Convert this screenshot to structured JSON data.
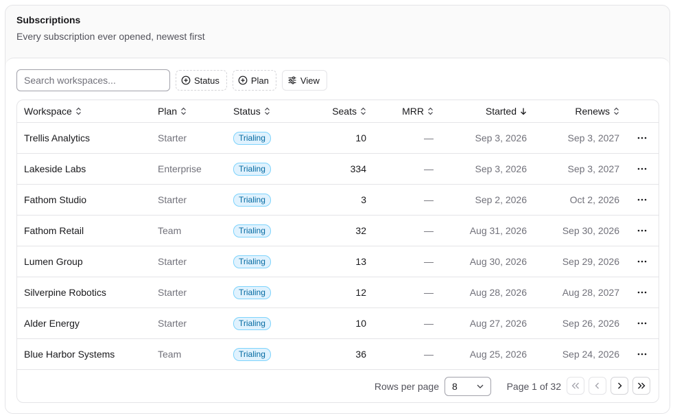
{
  "header": {
    "title": "Subscriptions",
    "subtitle": "Every subscription ever opened, newest first"
  },
  "toolbar": {
    "search_placeholder": "Search workspaces...",
    "status_label": "Status",
    "plan_label": "Plan",
    "view_label": "View"
  },
  "table": {
    "columns": {
      "workspace": "Workspace",
      "plan": "Plan",
      "status": "Status",
      "seats": "Seats",
      "mrr": "MRR",
      "started": "Started",
      "renews": "Renews"
    },
    "rows": [
      {
        "workspace": "Trellis Analytics",
        "plan": "Starter",
        "status": "Trialing",
        "seats": "10",
        "mrr": "—",
        "started": "Sep 3, 2026",
        "renews": "Sep 3, 2027"
      },
      {
        "workspace": "Lakeside Labs",
        "plan": "Enterprise",
        "status": "Trialing",
        "seats": "334",
        "mrr": "—",
        "started": "Sep 3, 2026",
        "renews": "Sep 3, 2027"
      },
      {
        "workspace": "Fathom Studio",
        "plan": "Starter",
        "status": "Trialing",
        "seats": "3",
        "mrr": "—",
        "started": "Sep 2, 2026",
        "renews": "Oct 2, 2026"
      },
      {
        "workspace": "Fathom Retail",
        "plan": "Team",
        "status": "Trialing",
        "seats": "32",
        "mrr": "—",
        "started": "Aug 31, 2026",
        "renews": "Sep 30, 2026"
      },
      {
        "workspace": "Lumen Group",
        "plan": "Starter",
        "status": "Trialing",
        "seats": "13",
        "mrr": "—",
        "started": "Aug 30, 2026",
        "renews": "Sep 29, 2026"
      },
      {
        "workspace": "Silverpine Robotics",
        "plan": "Starter",
        "status": "Trialing",
        "seats": "12",
        "mrr": "—",
        "started": "Aug 28, 2026",
        "renews": "Aug 28, 2027"
      },
      {
        "workspace": "Alder Energy",
        "plan": "Starter",
        "status": "Trialing",
        "seats": "10",
        "mrr": "—",
        "started": "Aug 27, 2026",
        "renews": "Sep 26, 2026"
      },
      {
        "workspace": "Blue Harbor Systems",
        "plan": "Team",
        "status": "Trialing",
        "seats": "36",
        "mrr": "—",
        "started": "Aug 25, 2026",
        "renews": "Sep 24, 2026"
      }
    ]
  },
  "pagination": {
    "rows_per_page_label": "Rows per page",
    "rows_per_page_value": "8",
    "page_label": "Page 1 of 32"
  },
  "colors": {
    "badge_bg": "#e0f2fe",
    "badge_border": "#7dd3fc",
    "badge_text": "#0369a1"
  },
  "icons": {
    "filter": "plus-circle-icon",
    "view": "sliders-icon",
    "sort": "chevrons-up-down-icon",
    "sorted_desc": "arrow-down-icon",
    "row_menu": "more-horizontal-icon",
    "select": "chevron-down-icon",
    "first": "chevrons-left-icon",
    "prev": "chevron-left-icon",
    "next": "chevron-right-icon",
    "last": "chevrons-right-icon"
  }
}
